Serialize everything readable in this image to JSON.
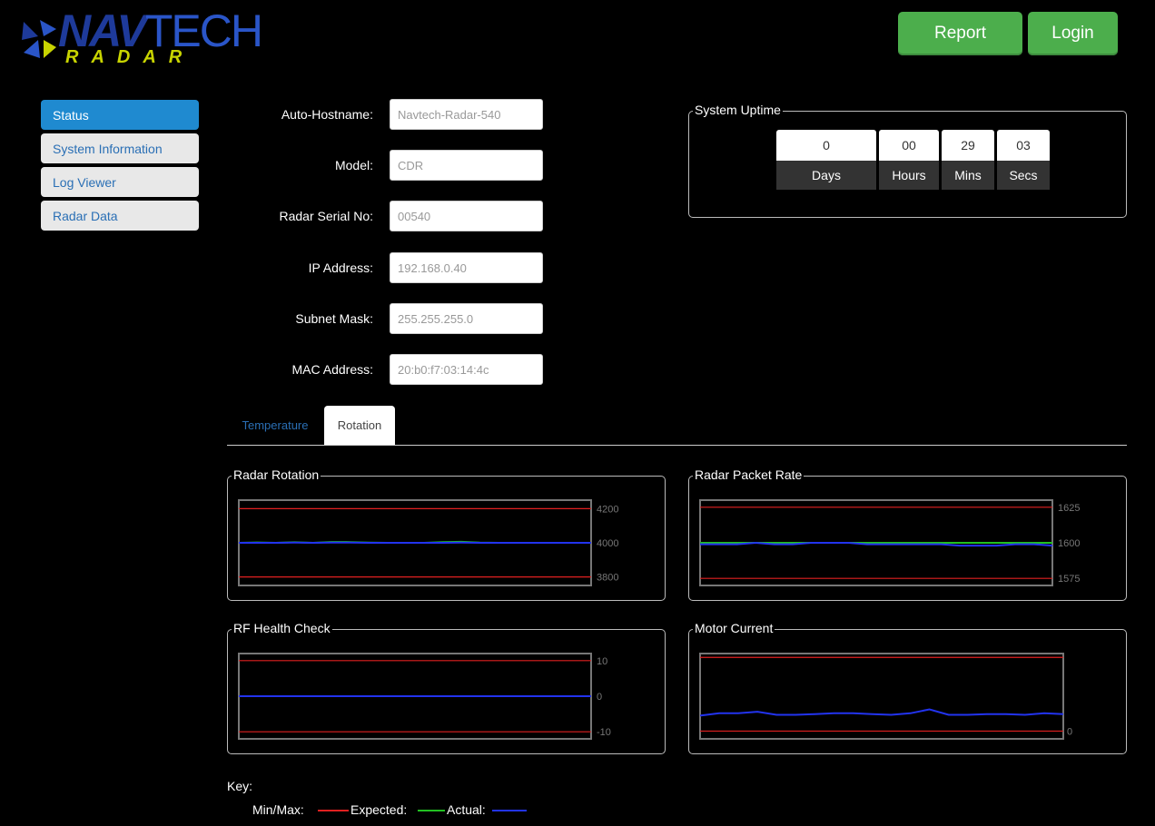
{
  "brand": {
    "logo_word_bold": "NAV",
    "logo_word_thin": "TECH",
    "logo_sub": "RADAR"
  },
  "header": {
    "report_label": "Report",
    "login_label": "Login"
  },
  "sidebar": {
    "items": [
      {
        "label": "Status",
        "active": true
      },
      {
        "label": "System Information",
        "active": false
      },
      {
        "label": "Log Viewer",
        "active": false
      },
      {
        "label": "Radar Data",
        "active": false
      }
    ]
  },
  "status_form": {
    "fields": [
      {
        "label": "Auto-Hostname:",
        "value": "Navtech-Radar-540"
      },
      {
        "label": "Model:",
        "value": "CDR"
      },
      {
        "label": "Radar Serial No:",
        "value": "00540"
      },
      {
        "label": "IP Address:",
        "value": "192.168.0.40"
      },
      {
        "label": "Subnet Mask:",
        "value": "255.255.255.0"
      },
      {
        "label": "MAC Address:",
        "value": "20:b0:f7:03:14:4c"
      }
    ]
  },
  "uptime": {
    "title": "System Uptime",
    "cells": [
      {
        "value": "0",
        "label": "Days"
      },
      {
        "value": "00",
        "label": "Hours"
      },
      {
        "value": "29",
        "label": "Mins"
      },
      {
        "value": "03",
        "label": "Secs"
      }
    ]
  },
  "tabs": [
    {
      "label": "Temperature",
      "active": false
    },
    {
      "label": "Rotation",
      "active": true
    }
  ],
  "colors": {
    "min_max": "#e02020",
    "expected": "#22c022",
    "actual": "#2233ee",
    "accent": "#1f8ad0",
    "button": "#4cae4c"
  },
  "chart_data": [
    {
      "type": "line",
      "title": "Radar Rotation",
      "yticks": [
        "4200",
        "4000",
        "3800"
      ],
      "ylim": [
        3750,
        4250
      ],
      "min": 3800,
      "max": 4200,
      "expected": 4000,
      "series": [
        {
          "role": "expected",
          "values": [
            4000,
            4002,
            4000,
            4003,
            4000,
            4005,
            4004,
            4001,
            4000,
            4000,
            4000,
            4004,
            4006,
            4001,
            4000,
            4000,
            4000,
            4000,
            4000,
            4000
          ]
        },
        {
          "role": "actual",
          "values": [
            4000,
            4000,
            4000,
            4001,
            4000,
            4001,
            4001,
            4000,
            4000,
            4000,
            4000,
            4000,
            4001,
            4000,
            4000,
            4000,
            4000,
            4000,
            4000,
            4000
          ]
        }
      ]
    },
    {
      "type": "line",
      "title": "Radar Packet Rate",
      "yticks": [
        "1625",
        "1600",
        "1575"
      ],
      "ylim": [
        1570,
        1630
      ],
      "min": 1575,
      "max": 1625,
      "expected": 1600,
      "series": [
        {
          "role": "expected",
          "values": [
            1600,
            1600,
            1600,
            1600,
            1600,
            1600,
            1600,
            1600,
            1600,
            1600,
            1600,
            1600,
            1600,
            1600,
            1600,
            1600,
            1600,
            1600,
            1600,
            1600
          ]
        },
        {
          "role": "actual",
          "values": [
            1599,
            1599,
            1599,
            1600,
            1599,
            1599,
            1600,
            1600,
            1600,
            1599,
            1599,
            1599,
            1599,
            1599,
            1598,
            1598,
            1598,
            1599,
            1599,
            1598
          ]
        }
      ]
    },
    {
      "type": "line",
      "title": "RF Health Check",
      "yticks": [
        "10",
        "0",
        "-10"
      ],
      "ylim": [
        -12,
        12
      ],
      "min": -10,
      "max": 10,
      "expected": 0,
      "series": [
        {
          "role": "expected",
          "values": [
            0,
            0,
            0,
            0,
            0,
            0,
            0,
            0,
            0,
            0,
            0,
            0,
            0,
            0,
            0,
            0,
            0,
            0,
            0,
            0
          ]
        },
        {
          "role": "actual",
          "values": [
            0,
            0,
            0,
            0,
            0,
            0,
            0,
            0,
            0,
            0,
            0,
            0,
            0,
            0,
            0,
            0,
            0,
            0,
            0,
            0
          ]
        }
      ]
    },
    {
      "type": "line",
      "title": "Motor Current",
      "yticks": [
        "0"
      ],
      "ylim": [
        -0.1,
        1.0
      ],
      "min": 0,
      "max": 0.95,
      "expected": null,
      "series": [
        {
          "role": "actual",
          "values": [
            0.2,
            0.23,
            0.23,
            0.25,
            0.21,
            0.21,
            0.22,
            0.23,
            0.23,
            0.22,
            0.21,
            0.23,
            0.28,
            0.21,
            0.21,
            0.22,
            0.22,
            0.21,
            0.23,
            0.22
          ]
        }
      ]
    }
  ],
  "key": {
    "title": "Key:",
    "min_max_label": "Min/Max:",
    "expected_label": "Expected:",
    "actual_label": "Actual:"
  }
}
